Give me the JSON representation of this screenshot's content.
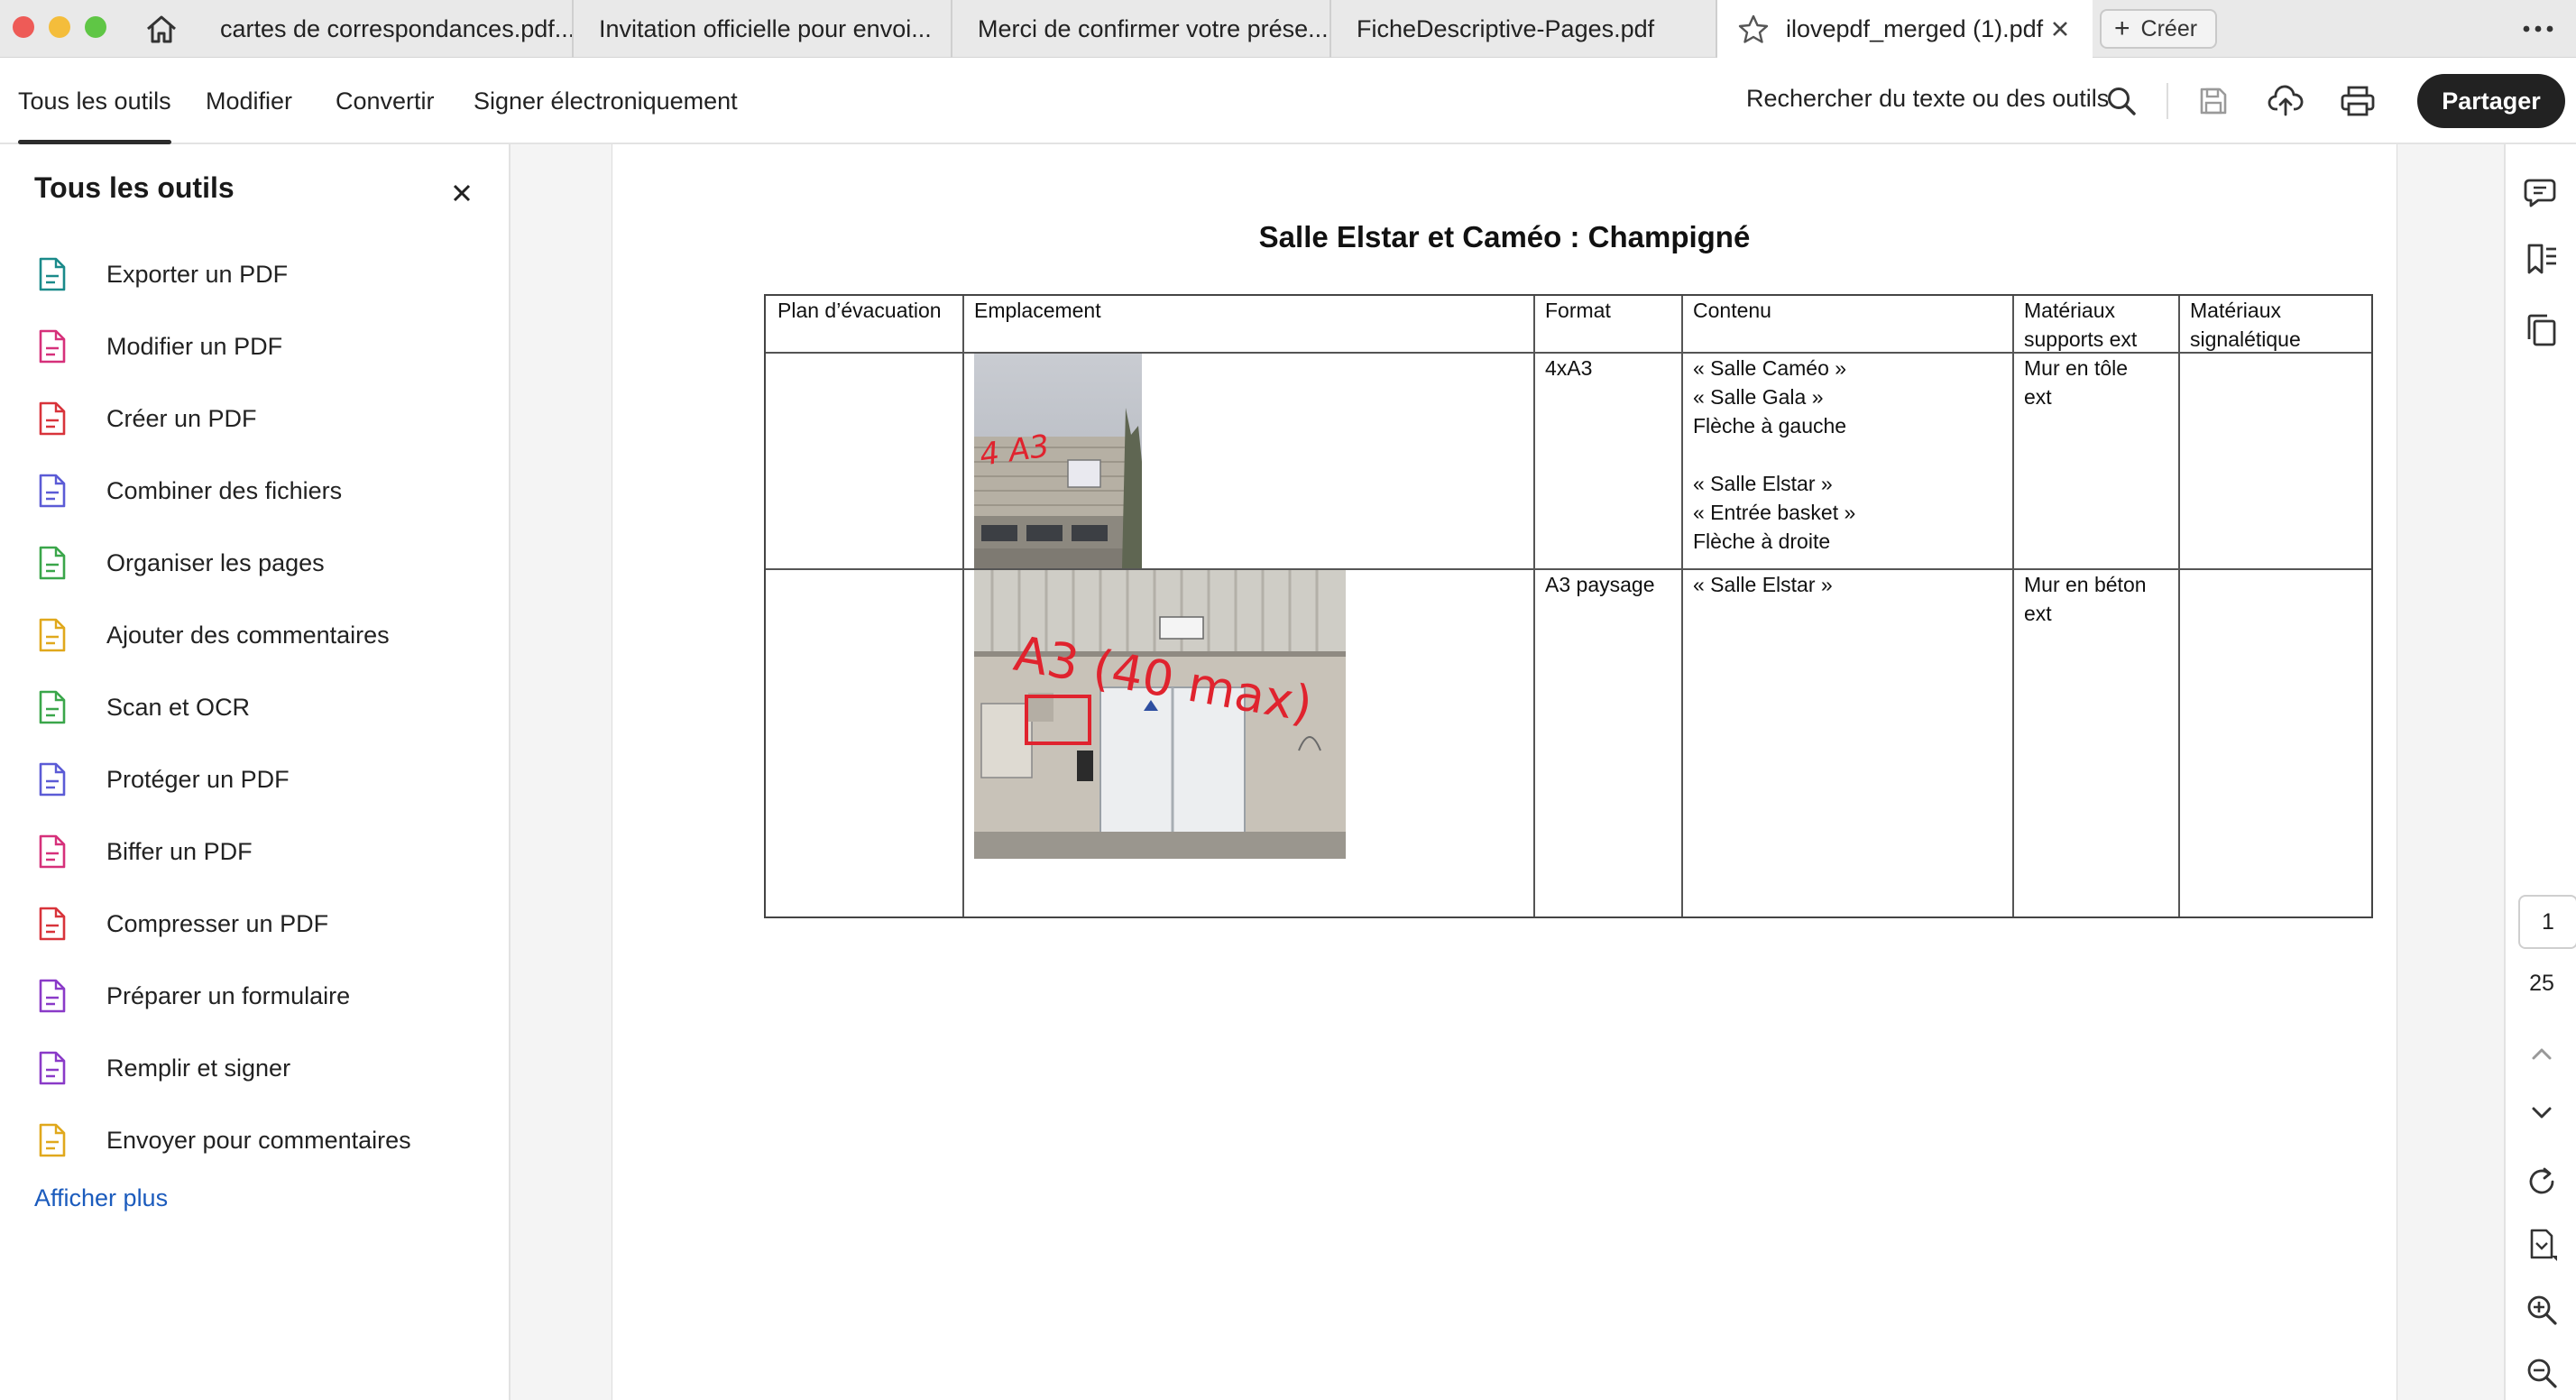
{
  "tabs": [
    {
      "label": "cartes de correspondances.pdf..."
    },
    {
      "label": "Invitation officielle pour envoi..."
    },
    {
      "label": "Merci de confirmer votre prése..."
    },
    {
      "label": "FicheDescriptive-Pages.pdf"
    },
    {
      "label": "ilovepdf_merged (1).pdf"
    }
  ],
  "tabbar": {
    "create_label": "Créer"
  },
  "toolbar": {
    "menu": [
      {
        "label": "Tous les outils"
      },
      {
        "label": "Modifier"
      },
      {
        "label": "Convertir"
      },
      {
        "label": "Signer électroniquement"
      }
    ],
    "search_label": "Rechercher du texte ou des outils",
    "share_label": "Partager"
  },
  "panel": {
    "title": "Tous les outils",
    "tools": [
      {
        "label": "Exporter un PDF",
        "icon": "export-pdf-icon",
        "color": "#1a8a8a"
      },
      {
        "label": "Modifier un PDF",
        "icon": "edit-pdf-icon",
        "color": "#d6307a"
      },
      {
        "label": "Créer un PDF",
        "icon": "create-pdf-icon",
        "color": "#d8333a"
      },
      {
        "label": "Combiner des fichiers",
        "icon": "combine-files-icon",
        "color": "#5b5bd6"
      },
      {
        "label": "Organiser les pages",
        "icon": "organize-pages-icon",
        "color": "#3aa64a"
      },
      {
        "label": "Ajouter des commentaires",
        "icon": "comment-icon",
        "color": "#e0a81c"
      },
      {
        "label": "Scan et OCR",
        "icon": "scan-ocr-icon",
        "color": "#3aa64a"
      },
      {
        "label": "Protéger un PDF",
        "icon": "protect-pdf-icon",
        "color": "#5b5bd6"
      },
      {
        "label": "Biffer un PDF",
        "icon": "redact-pdf-icon",
        "color": "#d6307a"
      },
      {
        "label": "Compresser un PDF",
        "icon": "compress-pdf-icon",
        "color": "#d8333a"
      },
      {
        "label": "Préparer un formulaire",
        "icon": "prepare-form-icon",
        "color": "#8a3ac8"
      },
      {
        "label": "Remplir et signer",
        "icon": "fill-sign-icon",
        "color": "#8a3ac8"
      },
      {
        "label": "Envoyer pour commentaires",
        "icon": "send-comments-icon",
        "color": "#e0a81c"
      }
    ],
    "show_more": "Afficher plus"
  },
  "document": {
    "title": "Salle Elstar et Caméo :  Champigné",
    "headers": [
      "Plan d’évacuation",
      "Emplacement",
      "Format",
      "Contenu",
      "Matériaux\nsupports ext",
      "Matériaux\nsignalétique"
    ],
    "rows": [
      {
        "plan": "",
        "format": "4xA3",
        "contenu": "« Salle Caméo »\n« Salle Gala »\nFlèche à gauche\n\n« Salle Elstar »\n« Entrée basket »\nFlèche à droite",
        "supports": "Mur en tôle\next",
        "signaletique": "",
        "photo_annotation": "4 A3"
      },
      {
        "plan": "",
        "format": "A3 paysage",
        "contenu": "« Salle Elstar »",
        "supports": "Mur en béton\next",
        "signaletique": "",
        "photo_annotation": "A3 (40 max)"
      }
    ]
  },
  "pagination": {
    "current": "1",
    "total": "25"
  },
  "colors": {
    "accent_link": "#1b5bbd",
    "share_bg": "#222222",
    "annotation": "#e0232e"
  }
}
